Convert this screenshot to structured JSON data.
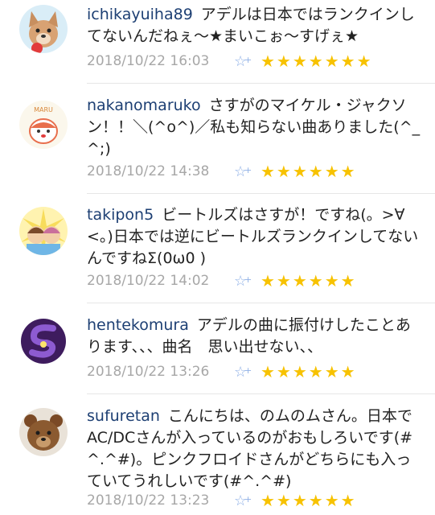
{
  "comments": [
    {
      "username": "ichikayuiha89",
      "text": "アデルは日本ではランクインしてないんだねぇ〜★まいこぉ〜すげぇ★",
      "date": "2018/10/22 16:03",
      "stars": "★★★★★★★"
    },
    {
      "username": "nakanomaruko",
      "text": "さすがのマイケル・ジャクソン！！＼(^o^)／私も知らない曲ありました(^_^;)",
      "date": "2018/10/22 14:38",
      "stars": "★★★★★★"
    },
    {
      "username": "takipon5",
      "text": "ビートルズはさすが！ですね(。>∀<。)日本では逆にビートルズランクインしてないんですねΣ(0ω0 )",
      "date": "2018/10/22 14:02",
      "stars": "★★★★★★"
    },
    {
      "username": "hentekomura",
      "text": "アデルの曲に振付けしたことあります、、、曲名　思い出せない、、",
      "date": "2018/10/22 13:26",
      "stars": "★★★★★★"
    },
    {
      "username": "sufuretan",
      "text": "こんにちは、のムのムさん。日本でAC/DCさんが入っているのがおもしろいです(#^.^#)。ピンクフロイドさんがどちらにも入っていてうれしいです(#^.^#)",
      "date": "2018/10/22 13:23",
      "stars": "★★★★★★"
    }
  ],
  "icons": {
    "favorite": "star-plus-icon",
    "rating": "rating-stars-icon"
  },
  "avatar_label": "MARU",
  "colors": {
    "username": "#1d3f73",
    "date": "#a7a7a7",
    "star": "#f7c200",
    "favorite": "#8fb0e6"
  }
}
